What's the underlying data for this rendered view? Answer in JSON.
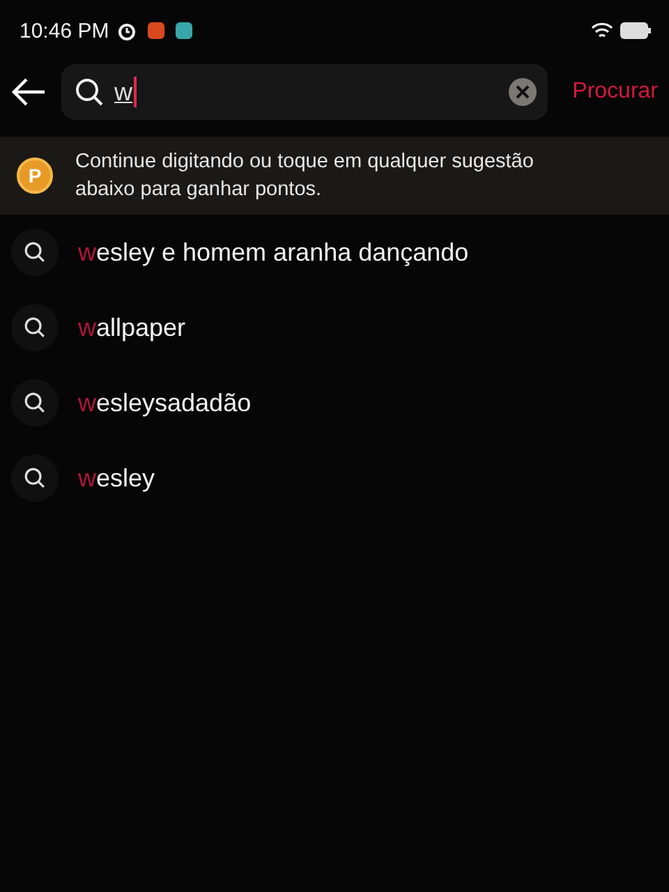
{
  "status_bar": {
    "time": "10:46 PM"
  },
  "search": {
    "value": "w",
    "action": "Procurar"
  },
  "hint": {
    "badge": "P",
    "text": "Continue digitando ou toque em qualquer sugestão abaixo para ganhar pontos."
  },
  "suggestions": [
    {
      "text": "wesley e homem aranha dançando"
    },
    {
      "text": "wallpaper"
    },
    {
      "text": "wesleysadadão"
    },
    {
      "text": "wesley"
    }
  ]
}
